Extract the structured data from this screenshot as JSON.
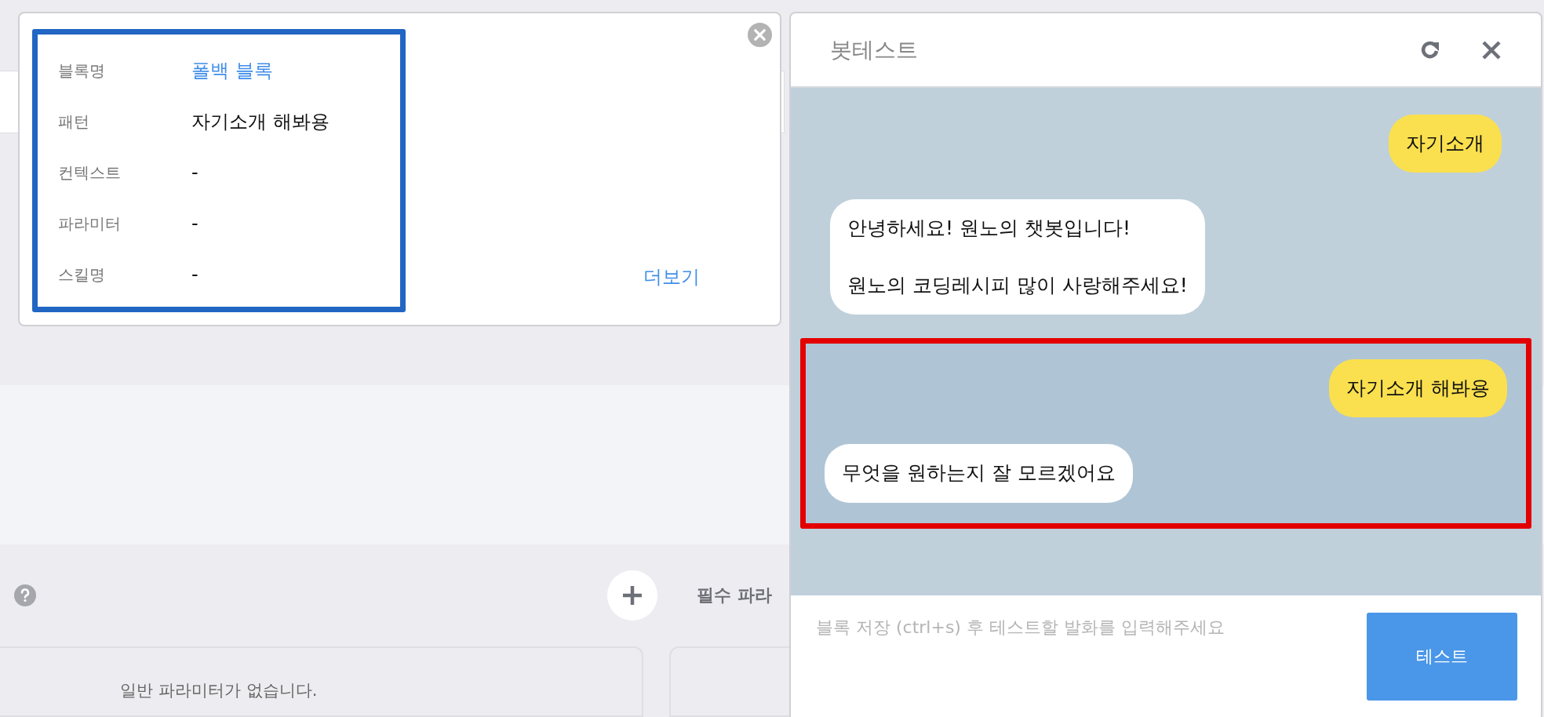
{
  "background": {
    "required_section_title": "필수 파라",
    "general_params_empty": "일반 파라미터가 없습니다."
  },
  "block_popup": {
    "rows": [
      {
        "label": "블록명",
        "value": "폴백 블록",
        "kind": "link"
      },
      {
        "label": "패턴",
        "value": "자기소개 해봐용",
        "kind": "text"
      },
      {
        "label": "컨텍스트",
        "value": "-",
        "kind": "text"
      },
      {
        "label": "파라미터",
        "value": "-",
        "kind": "text"
      },
      {
        "label": "스킬명",
        "value": "-",
        "kind": "text"
      }
    ],
    "more_link": "더보기"
  },
  "bot_test": {
    "title": "봇테스트",
    "messages": [
      {
        "kind": "user",
        "text": "자기소개",
        "highlighted": false
      },
      {
        "kind": "bot",
        "text": "안녕하세요! 원노의 챗봇입니다!\n\n원노의 코딩레시피 많이 사랑해주세요!",
        "highlighted": false
      },
      {
        "kind": "user",
        "text": "자기소개 해봐용",
        "highlighted": true
      },
      {
        "kind": "bot",
        "text": "무엇을 원하는지 잘 모르겠어요",
        "highlighted": true
      }
    ],
    "input": {
      "placeholder": "블록 저장 (ctrl+s) 후 테스트할 발화를 입력해주세요"
    },
    "send_button": "테스트"
  }
}
